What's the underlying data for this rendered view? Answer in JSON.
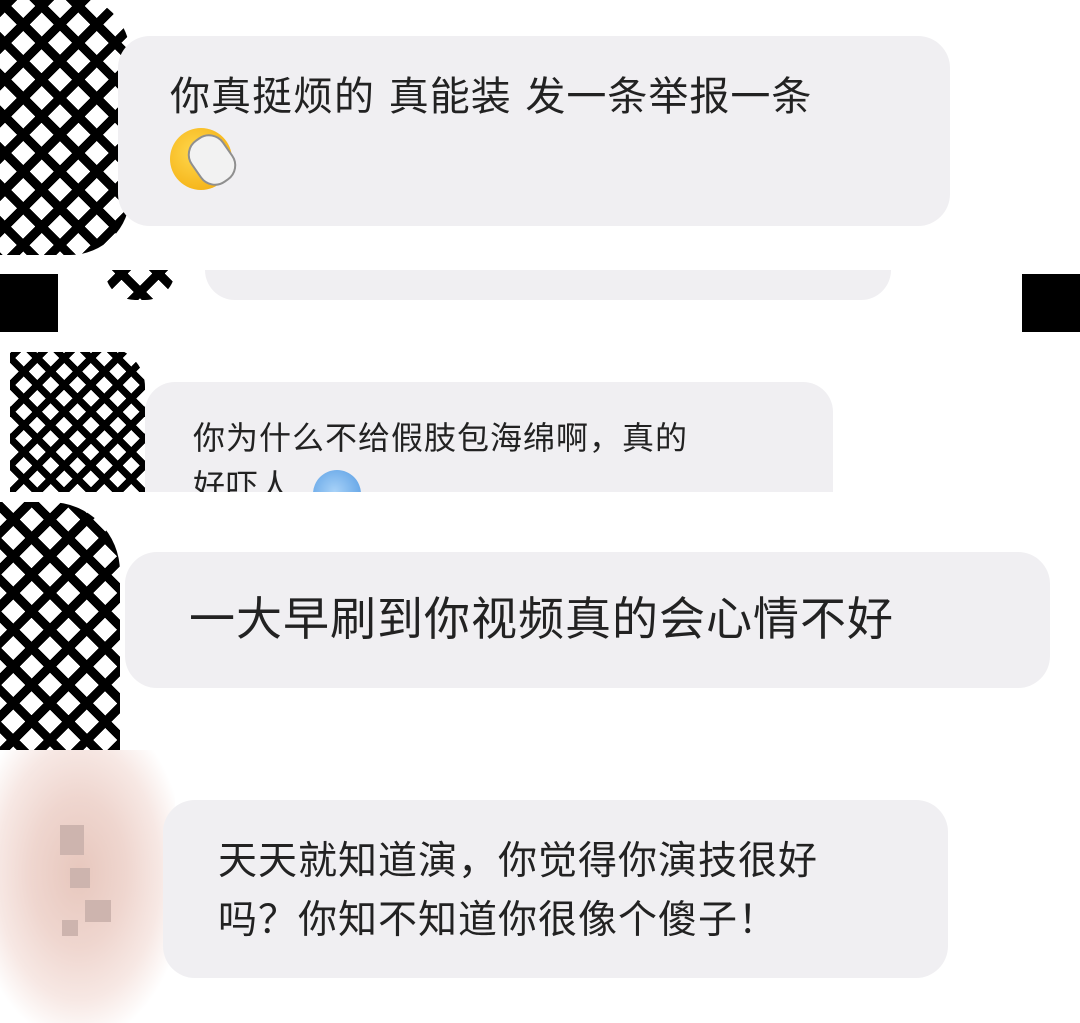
{
  "comments": [
    {
      "text": "你真挺烦的 真能装 发一条举报一条",
      "emoji": "slipper-emoji"
    },
    {
      "text": "你为什么不给假肢包海绵啊，真的\n好吓人",
      "emoji": "sweat-emoji"
    },
    {
      "text": "一大早刷到你视频真的会心情不好"
    },
    {
      "text": "天天就知道演，你觉得你演技很好\n吗？你知不知道你很像个傻子！"
    }
  ],
  "colors": {
    "bubble": "#f0eff2",
    "text": "#222222",
    "redaction": "#000000"
  }
}
